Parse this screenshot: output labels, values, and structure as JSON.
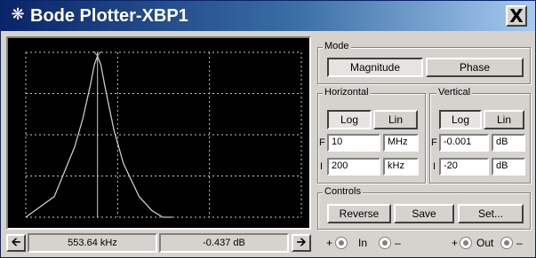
{
  "window": {
    "title": "Bode Plotter-XBP1",
    "title_icon": "bode-plotter-icon",
    "close_label": "X"
  },
  "mode": {
    "label": "Mode",
    "magnitude_label": "Magnitude",
    "phase_label": "Phase",
    "selected": "Magnitude"
  },
  "horizontal": {
    "label": "Horizontal",
    "log_label": "Log",
    "lin_label": "Lin",
    "selected": "Log",
    "f_label": "F",
    "f_value": "10",
    "f_unit": "MHz",
    "i_label": "I",
    "i_value": "200",
    "i_unit": "kHz"
  },
  "vertical": {
    "label": "Vertical",
    "log_label": "Log",
    "lin_label": "Lin",
    "selected": "Log",
    "f_label": "F",
    "f_value": "-0.001",
    "f_unit": "dB",
    "i_label": "I",
    "i_value": "-20",
    "i_unit": "dB"
  },
  "controls": {
    "label": "Controls",
    "reverse_label": "Reverse",
    "save_label": "Save",
    "set_label": "Set..."
  },
  "cursor": {
    "left_arrow": "left-arrow-icon",
    "right_arrow": "right-arrow-icon",
    "frequency_readout": "553.64 kHz",
    "gain_readout": "-0.437 dB"
  },
  "terminals": {
    "in_plus": "+",
    "in_label": "In",
    "in_minus": "–",
    "out_plus": "+",
    "out_label": "Out",
    "out_minus": "–"
  },
  "colors": {
    "plot_background": "#000000",
    "trace": "#c8c8c8",
    "grid": "#c8c8c8",
    "cursor": "#c8c8c8",
    "title_gradient_start": "#0a246a",
    "title_gradient_end": "#a6caf0"
  },
  "chart_data": {
    "type": "line",
    "x_scale": "log",
    "x_range_hz": [
      200000,
      10000000
    ],
    "y_range_db": [
      -20,
      -0.001
    ],
    "cursor_x_hz": 553640,
    "cursor_y_db": -0.437,
    "series": [
      {
        "x": [
          200000,
          300000,
          400000,
          450000,
          500000,
          530000,
          553640,
          580000,
          620000,
          700000,
          800000,
          1000000,
          1200000,
          1400000,
          1600000
        ],
        "values": [
          -20,
          -17.5,
          -11.5,
          -8.0,
          -4.0,
          -1.5,
          -0.437,
          -1.5,
          -4.5,
          -9.5,
          -13.5,
          -17.5,
          -19.2,
          -20,
          -20
        ]
      }
    ]
  }
}
